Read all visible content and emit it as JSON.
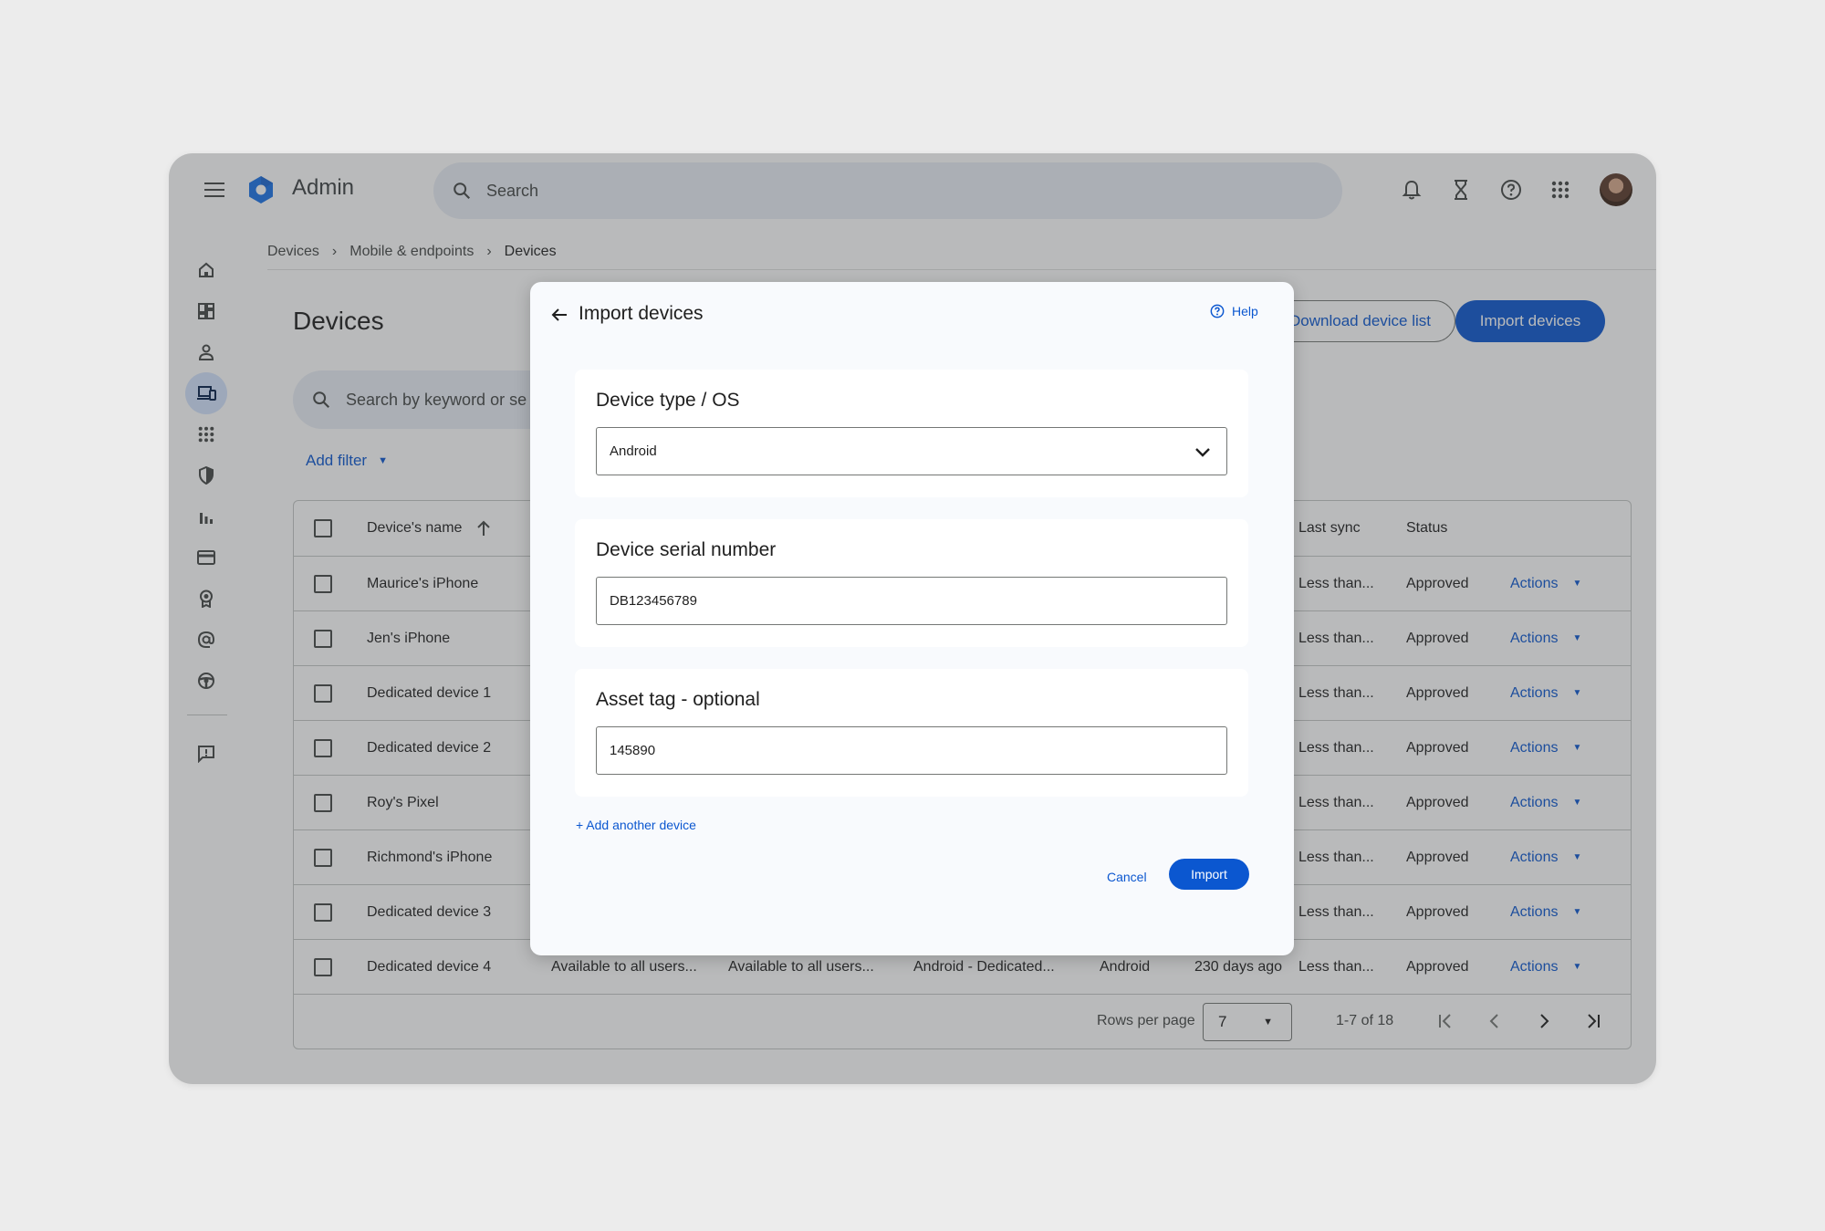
{
  "header": {
    "app_title": "Admin",
    "search_placeholder": "Search"
  },
  "breadcrumb": [
    "Devices",
    "Mobile & endpoints",
    "Devices"
  ],
  "page": {
    "title": "Devices",
    "download_label": "Download device list",
    "import_label": "Import devices",
    "search_placeholder": "Search by keyword or se",
    "add_filter_label": "Add filter"
  },
  "table": {
    "headers": {
      "name": "Device's name",
      "last_sync": "Last sync",
      "status": "Status"
    },
    "rows": [
      {
        "name": "Maurice's iPhone",
        "last_sync": "Less than...",
        "status": "Approved",
        "action": "Actions"
      },
      {
        "name": "Jen's iPhone",
        "last_sync": "Less than...",
        "status": "Approved",
        "action": "Actions"
      },
      {
        "name": "Dedicated device 1",
        "last_sync": "Less than...",
        "status": "Approved",
        "action": "Actions"
      },
      {
        "name": "Dedicated device 2",
        "last_sync": "Less than...",
        "status": "Approved",
        "action": "Actions"
      },
      {
        "name": "Roy's Pixel",
        "last_sync": "Less than...",
        "status": "Approved",
        "action": "Actions"
      },
      {
        "name": "Richmond's iPhone",
        "last_sync": "Less than...",
        "status": "Approved",
        "action": "Actions"
      },
      {
        "name": "Dedicated device 3",
        "last_sync": "Less than...",
        "status": "Approved",
        "action": "Actions"
      },
      {
        "name": "Dedicated device 4",
        "col2": "Available to all users...",
        "col3": "Available to all users...",
        "col4": "Android - Dedicated...",
        "col5": "Android",
        "col6": "230 days ago",
        "last_sync": "Less than...",
        "status": "Approved",
        "action": "Actions"
      }
    ],
    "pager": {
      "rows_per_page_label": "Rows per page",
      "rows_per_page_value": "7",
      "range": "1-7 of 18"
    }
  },
  "dialog": {
    "title": "Import devices",
    "help_label": "Help",
    "device_type": {
      "label": "Device type / OS",
      "value": "Android"
    },
    "serial": {
      "label": "Device serial number",
      "value": "DB123456789"
    },
    "asset_tag": {
      "label": "Asset tag - optional",
      "value": "145890"
    },
    "add_another_label": "+ Add another device",
    "cancel_label": "Cancel",
    "import_label": "Import"
  },
  "colors": {
    "accent": "#0b57d0",
    "scrim": "#3c4043"
  }
}
